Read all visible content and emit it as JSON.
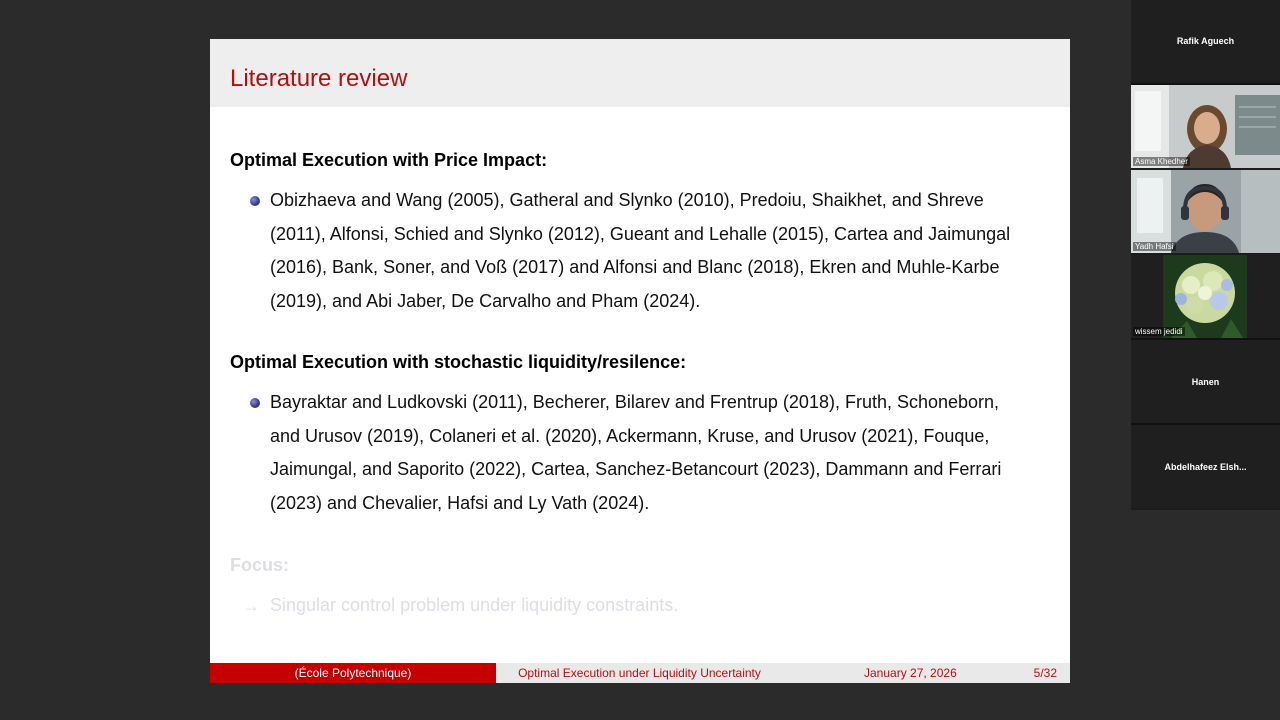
{
  "slide": {
    "title": "Literature review",
    "section1": {
      "heading": "Optimal Execution with Price Impact:",
      "lines": [
        "Obizhaeva and Wang (2005), Gatheral and Slynko (2010), Predoiu, Shaikhet, and Shreve",
        "(2011), Alfonsi, Schied and Slynko (2012), Gueant and Lehalle (2015), Cartea and Jaimungal",
        "(2016), Bank, Soner, and Voß (2017) and Alfonsi and Blanc (2018), Ekren and Muhle-Karbe",
        "(2019), and Abi Jaber, De Carvalho and Pham (2024)."
      ]
    },
    "section2": {
      "heading": "Optimal Execution with stochastic liquidity/resilence:",
      "lines": [
        "Bayraktar and Ludkovski (2011), Becherer, Bilarev and Frentrup (2018), Fruth, Schoneborn,",
        "and Urusov (2019), Colaneri et al. (2020), Ackermann, Kruse, and Urusov (2021), Fouque,",
        "Jaimungal, and Saporito (2022), Cartea, Sanchez-Betancourt (2023), Dammann and Ferrari",
        "(2023) and Chevalier, Hafsi and Ly Vath (2024)."
      ]
    },
    "focus": {
      "heading": "Focus:",
      "arrow": "→",
      "text": "Singular control problem under liquidity constraints."
    },
    "footer": {
      "institution": "(École Polytechnique)",
      "talk_title": "Optimal Execution under Liquidity Uncertainty",
      "date": "January 27, 2026",
      "page": "5/32"
    },
    "colors": {
      "title_red": "#b80d0d",
      "footer_red": "#c40000",
      "bullet_blue": "#3a3f8f"
    }
  },
  "participants": [
    {
      "name": "Rafik Aguech",
      "video": false
    },
    {
      "name": "Asma Khedher",
      "video": true
    },
    {
      "name": "Yadh Hafsi",
      "video": true
    },
    {
      "name": "wissem jedidi",
      "video": true
    },
    {
      "name": "Hanen",
      "video": false
    },
    {
      "name": "Abdelhafeez Elsh...",
      "video": false
    }
  ]
}
